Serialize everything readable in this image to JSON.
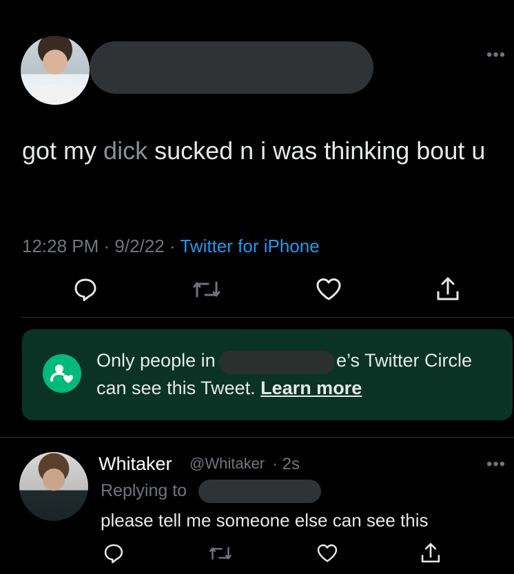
{
  "tweet": {
    "text_before": "got my ",
    "text_faded": "dick",
    "text_after": " sucked n i was thinking bout u",
    "time": "12:28 PM",
    "date": "9/2/22",
    "source": "Twitter for iPhone",
    "more_icon": "more-icon"
  },
  "circle_notice": {
    "line1_start": "Only people in",
    "line1_end": "e’s Twitter Circle",
    "line2": "can see this Tweet.",
    "learn_more": "Learn more",
    "accent": "#00ba7c",
    "background": "#0a3325"
  },
  "reply": {
    "name": "Whitaker",
    "handle": "@Whitaker",
    "time": "· 2s",
    "replying_to": "Replying to",
    "text": "please tell me someone else can see this"
  },
  "icons": {
    "reply": "reply-icon",
    "retweet": "retweet-icon",
    "like": "like-icon",
    "share": "share-icon"
  },
  "colors": {
    "background": "#000000",
    "text": "#e7e9ea",
    "muted": "#71767b",
    "link": "#1d9bf0",
    "divider": "#2f3336"
  }
}
